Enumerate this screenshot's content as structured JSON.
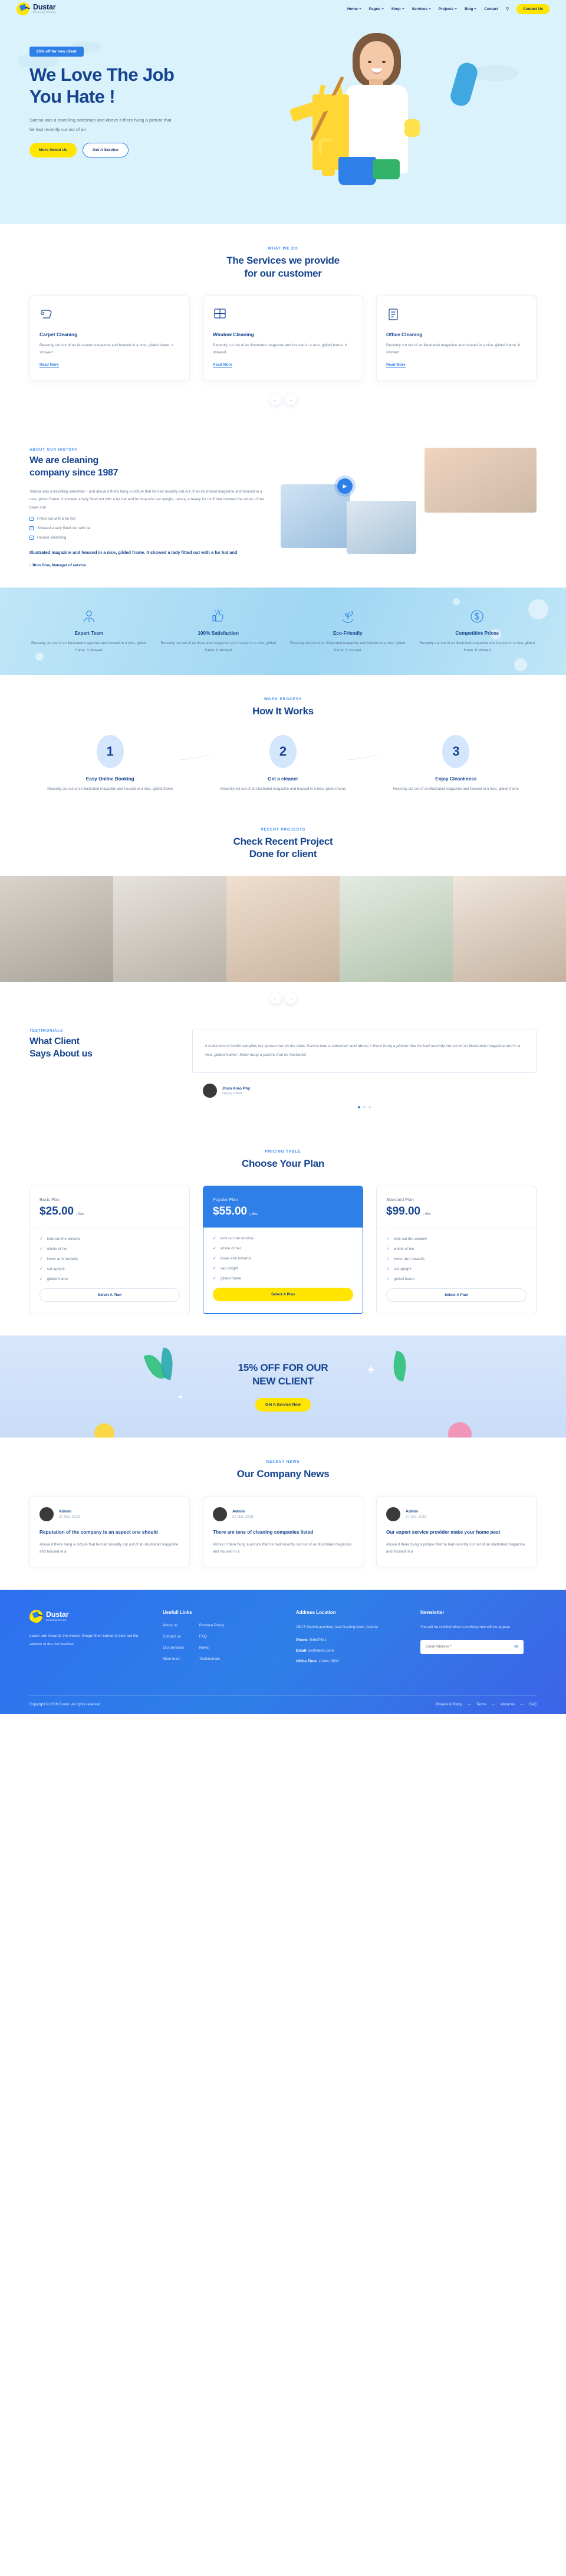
{
  "brand": {
    "name": "Dustar",
    "tagline": "Cleaning Service"
  },
  "nav": {
    "items": [
      {
        "label": "Home",
        "caret": true
      },
      {
        "label": "Pages",
        "caret": true
      },
      {
        "label": "Shop",
        "caret": true
      },
      {
        "label": "Services",
        "caret": true
      },
      {
        "label": "Projects",
        "caret": true
      },
      {
        "label": "Blog",
        "caret": true
      },
      {
        "label": "Contact",
        "caret": false
      }
    ],
    "search_icon": "search-icon",
    "cta": "Contact Us"
  },
  "hero": {
    "badge": "25% off for new client",
    "title_line1": "We Love The Job",
    "title_line2": "You Hate !",
    "desc": "Samsa was a travelling salesman and above it there hung a picture that he had recently cut out of an",
    "btn_primary": "More About Us",
    "btn_secondary": "Get A Service"
  },
  "services": {
    "eyebrow": "WHAT WE DO",
    "title_line1": "The Services we provide",
    "title_line2": "for our customer",
    "cards": [
      {
        "icon": "carpet-icon",
        "name": "Carpet Cleaning",
        "desc": "Recently cut out of an illustrated magazine and housed in a nice, gilded frame. It showed",
        "link": "Read More"
      },
      {
        "icon": "window-icon",
        "name": "Window Cleaning",
        "desc": "Recently cut out of an illustrated magazine and housed in a nice, gilded frame. It showed",
        "link": "Read More"
      },
      {
        "icon": "office-icon",
        "name": "Office Cleaning",
        "desc": "Recently cut out of an illustrated magazine and housed in a nice, gilded frame. It showed",
        "link": "Read More"
      }
    ],
    "prev": "←",
    "next": "→"
  },
  "about": {
    "eyebrow": "ABOUT OUR HISTORY",
    "title_line1": "We are cleaning",
    "title_line2": "company since 1987",
    "desc": "Samsa was a travelling salesman - and above it there hung a picture that he had recently cut out of an illustrated magazine and housed in a nice, gilded frame. It showed a lady fitted out with a fur hat and fur boa who sat upright, raising a heavy fur muff that covered the whole of her lower arm",
    "checks": [
      "Fitted out with a fur hat",
      "Showed a lady fitted our with far.",
      "Hourse cleansing"
    ],
    "quote": "Illustrated magazine and housed in a nice, gilded frame. It showed a lady fitted out with a fur hat and",
    "author": "- Jhon Dow, Manager of service",
    "play_icon": "play-icon"
  },
  "features": {
    "items": [
      {
        "icon": "team-icon",
        "title": "Expert Team",
        "desc": "Recently cut out of an illustrated magazine and housed in a nice, gilded frame. It showed"
      },
      {
        "icon": "thumbs-up-icon",
        "title": "100% Satisfaction",
        "desc": "Recently cut out of an illustrated magazine and housed in a nice, gilded frame. It showed"
      },
      {
        "icon": "eco-plant-icon",
        "title": "Eco-Friendly",
        "desc": "Recently cut out of an illustrated magazine and housed in a nice, gilded frame. It showed"
      },
      {
        "icon": "dollar-coin-icon",
        "title": "Competitive Prices",
        "desc": "Recently cut out of an illustrated magazine and housed in a nice, gilded frame. It showed"
      }
    ]
  },
  "how": {
    "eyebrow": "WORK PROCESS",
    "title": "How It Works",
    "steps": [
      {
        "num": "1",
        "title": "Easy Online Booking",
        "desc": "Recently cut out of an illustrated magazine and housed in a nice, gilded frame"
      },
      {
        "num": "2",
        "title": "Get a cleaner",
        "desc": "Recently cut out of an illustrated magazine and housed in a nice, gilded frame"
      },
      {
        "num": "3",
        "title": "Enjoy Cleanliness",
        "desc": "Recently cut out of an illustrated magazine and housed in a nice, gilded frame"
      }
    ]
  },
  "projects": {
    "eyebrow": "RECENT PROJECTS",
    "title_line1": "Check Recent Project",
    "title_line2": "Done for client",
    "prev": "←",
    "next": "→"
  },
  "testimonials": {
    "eyebrow": "TESTIMONIALS",
    "title_line1": "What Client",
    "title_line2": "Says About us",
    "quote": "A collection of textile samples lay spread out on the table Samsa was a salesman and above it there hung a picture that he had recently cut out of an illustrated magazine and in a nice, gilded frame t there hung a picture that he llustrated",
    "name": "Jhon Amo Phy",
    "role": "Happy Client",
    "prev": "←",
    "next": "→"
  },
  "pricing": {
    "eyebrow": "PRICING TABLE",
    "title": "Choose Your Plan",
    "plans": [
      {
        "name": "Basic Plan",
        "price": "$25.00",
        "per": "/Mo",
        "popular": false,
        "features": [
          "look out the window",
          "whole of her",
          "lower arm towards",
          "sat upright",
          "gilded frame"
        ],
        "button": "Select A Plan"
      },
      {
        "name": "Popular Plan",
        "price": "$55.00",
        "per": "/Mo",
        "popular": true,
        "features": [
          "look out the window",
          "whole of her",
          "lower arm towards",
          "sat upright",
          "gilded frame"
        ],
        "button": "Select A Plan"
      },
      {
        "name": "Standard Plan",
        "price": "$99.00",
        "per": "/Mo",
        "popular": false,
        "features": [
          "look out the window",
          "whole of her",
          "lower arm towards",
          "sat upright",
          "gilded frame"
        ],
        "button": "Select A Plan"
      }
    ]
  },
  "cta": {
    "line1": "15% OFF FOR OUR",
    "line2": "NEW CLIENT",
    "button": "Get A Service Now"
  },
  "news": {
    "eyebrow": "RECENT NEWS",
    "title": "Our Company News",
    "posts": [
      {
        "author": "Admin",
        "date": "27 Oct, 2019",
        "title": "Reputation of the company is an aspect one should",
        "excerpt": "Above it there hung a picture that he had recently cut out of an illustrated magazine and housed in a"
      },
      {
        "author": "Admin",
        "date": "27 Oct, 2019",
        "title": "There are tens of cleaning companies listed",
        "excerpt": "Above it there hung a picture that he had recently cut out of an illustrated magazine and housed in a"
      },
      {
        "author": "Admin",
        "date": "27 Oct, 2019",
        "title": "Our expert service provider make your home pest",
        "excerpt": "Above it there hung a picture that he had recently cut out of an illustrated magazine and housed in a"
      }
    ]
  },
  "footer": {
    "about": "Lower arm towards the viewer. Gregor then turned to look out the window ot the dull weather",
    "links_heading": "Usefull Links",
    "links_col1": [
      "About us",
      "Contact us",
      "Our services",
      "Meet team"
    ],
    "links_col2": [
      "Provacu Policy",
      "FAQ",
      "News",
      "Testimonials"
    ],
    "address_heading": "Address Location",
    "address": "15/17 Marvel aveniew, new Dusting town, Austria",
    "phone_label": "Phone:",
    "phone": "54647541",
    "email_label": "Email:",
    "email": "ex@demo.com",
    "office_label": "Office Time:",
    "office": "10AM- 5PM",
    "newsletter_heading": "Newsletter",
    "newsletter_text": "You will be notified when somthing new will be appear.",
    "newsletter_placeholder": "Email Address *",
    "newsletter_value": "",
    "send_icon": "envelope-icon",
    "copyright": "Copyright © 2019 Duster. All rights reserved.",
    "bottom_links": [
      "Privace & Policy",
      "Terms",
      "About us",
      "FAQ"
    ]
  },
  "colors": {
    "accent": "#2f7fe8",
    "yellow": "#ffe500",
    "navy": "#16448f",
    "sky": "#d9f2fb"
  }
}
